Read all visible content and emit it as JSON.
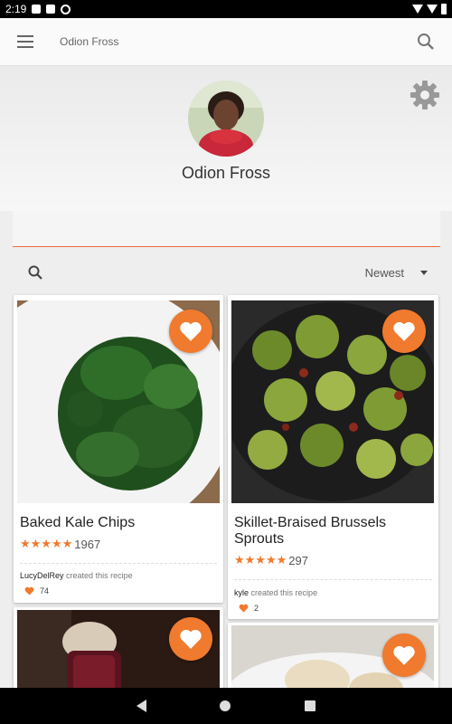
{
  "status_bar": {
    "time": "2:19"
  },
  "toolbar": {
    "title": "Odion Fross"
  },
  "profile": {
    "name": "Odion Fross"
  },
  "filter": {
    "sort_selected": "Newest"
  },
  "colors": {
    "accent": "#f07a2d",
    "field_underline": "#ef6c3a"
  },
  "recipes": [
    {
      "title": "Baked Kale Chips",
      "rating": 4.5,
      "review_count": "1967",
      "creator": "LucyDelRey",
      "created_text": "created this recipe",
      "likes": "74"
    },
    {
      "title": "Skillet-Braised Brussels Sprouts",
      "rating": 4.5,
      "review_count": "297",
      "creator": "kyle",
      "created_text": "created this recipe",
      "likes": "2"
    }
  ],
  "icons": [
    "menu-icon",
    "search-icon",
    "gear-icon",
    "heart-icon",
    "star-icon",
    "back-icon",
    "home-icon",
    "recents-icon"
  ]
}
